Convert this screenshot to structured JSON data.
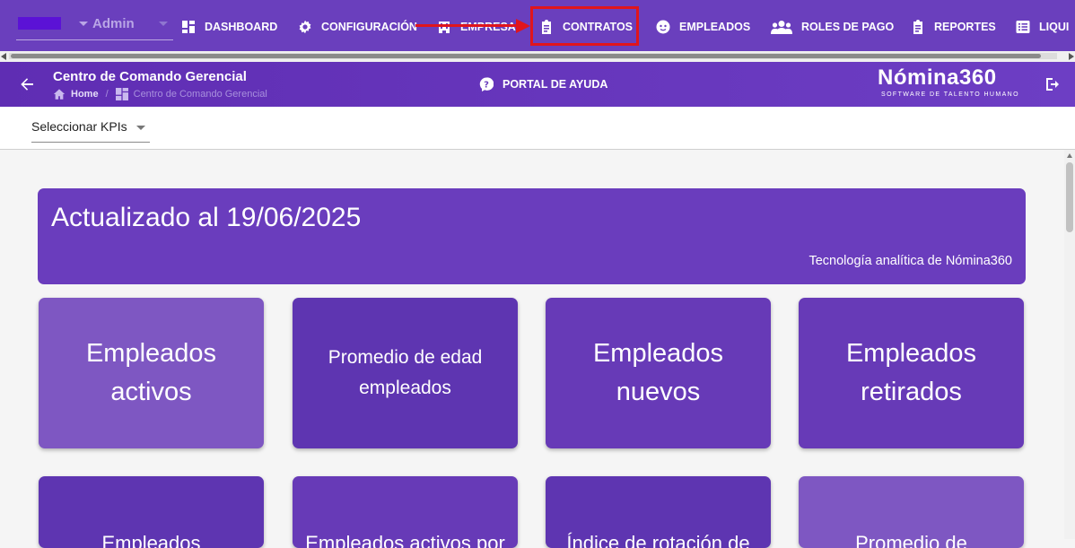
{
  "topbar": {
    "user_label": "Admin",
    "nav": [
      {
        "label": "DASHBOARD",
        "icon": "dashboard-icon"
      },
      {
        "label": "CONFIGURACIÓN",
        "icon": "gear-icon"
      },
      {
        "label": "EMPRESA",
        "icon": "building-icon"
      },
      {
        "label": "CONTRATOS",
        "icon": "clipboard-icon"
      },
      {
        "label": "EMPLEADOS",
        "icon": "employee-face-icon"
      },
      {
        "label": "ROLES DE PAGO",
        "icon": "users-group-icon"
      },
      {
        "label": "REPORTES",
        "icon": "report-clipboard-icon"
      },
      {
        "label": "LIQUI",
        "icon": "list-icon"
      }
    ],
    "highlight_color": "#e0151c"
  },
  "header": {
    "title": "Centro de Comando Gerencial",
    "breadcrumb_home": "Home",
    "breadcrumb_current": "Centro de Comando Gerencial",
    "help_label": "PORTAL DE AYUDA",
    "logo": "Nómina360",
    "logo_tagline": "SOFTWARE DE TALENTO HUMANO"
  },
  "kpi": {
    "select_label": "Seleccionar KPIs"
  },
  "banner": {
    "title": "Actualizado al 19/06/2025",
    "subtitle": "Tecnología analítica de Nómina360"
  },
  "cards_row1": [
    {
      "label": "Empleados activos",
      "color": "#7e57c2"
    },
    {
      "label": "Promedio de edad empleados",
      "color": "#5e35b1"
    },
    {
      "label": "Empleados nuevos",
      "color": "#673ab7"
    },
    {
      "label": "Empleados retirados",
      "color": "#673ab7"
    }
  ],
  "cards_row2": [
    {
      "label": "Empleados",
      "color": "#5e35b1"
    },
    {
      "label": "Empleados activos por",
      "color": "#673ab7"
    },
    {
      "label": "Índice de rotación de",
      "color": "#5e35b1"
    },
    {
      "label": "Promedio de",
      "color": "#7e57c2"
    }
  ]
}
